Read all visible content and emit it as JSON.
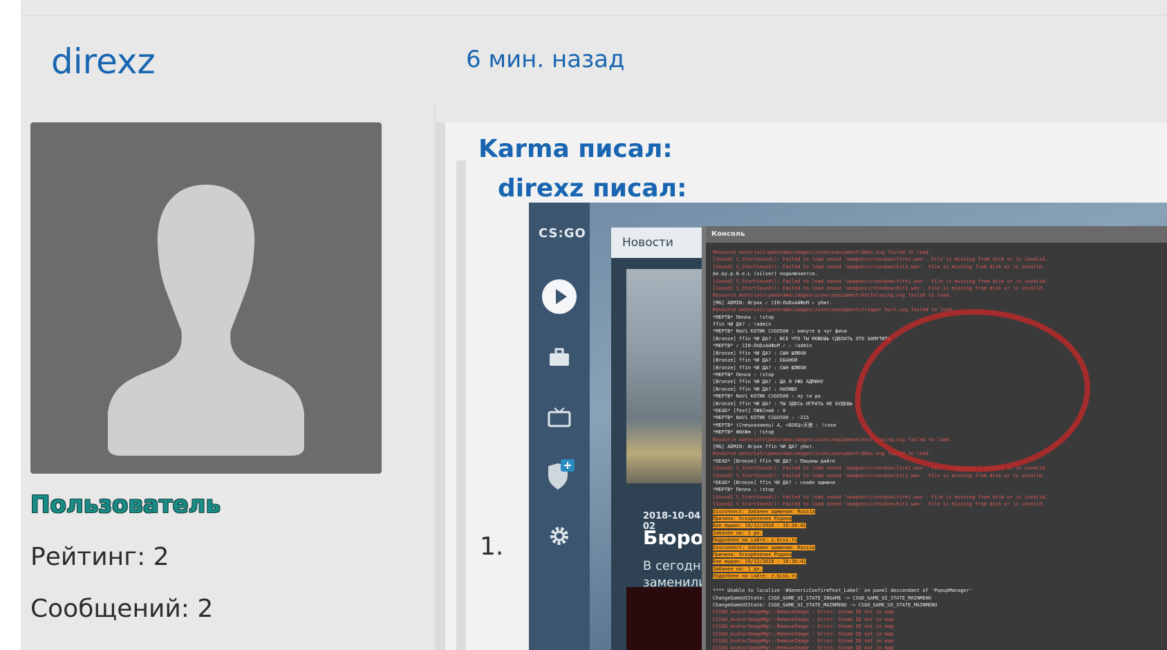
{
  "post": {
    "author": "direxz",
    "time": "6 мин. назад",
    "role": "Пользователь",
    "rating": "Рейтинг: 2",
    "messages": "Сообщений: 2"
  },
  "quotes": {
    "outer_header": "Karma писал:",
    "inner_header": "direxz писал:",
    "list_number": "1."
  },
  "screenshot": {
    "logo": "CS:GO",
    "news_header": "Новости",
    "news_date": "2018-10-04 02",
    "news_title": "Бюро",
    "news_text_1": "В сегодня",
    "news_text_2": "заменили",
    "console_title": "Консоль",
    "console_lines": [
      {
        "t": "Resource materials\\panorama\\images\\icons\\equipment\\dbox.svg failed to load.",
        "c": "red"
      },
      {
        "t": "[Sound] S_StartSound(): Failed to load sound 'weapons\\crossbow\\fire1.wav'. File is missing from disk or is invalid.",
        "c": "red"
      },
      {
        "t": "[Sound] S_StartSound(): Failed to load sound 'weapons\\crossbow\\hit1.wav'. File is missing from disk or is invalid.",
        "c": "red"
      },
      {
        "t": "Ae.&y.p.6.e.L (silver) подключается.",
        "c": "white"
      },
      {
        "t": "[Sound] S_StartSound(): Failed to load sound 'weapons\\crossbow\\fire1.wav'. File is missing from disk or is invalid.",
        "c": "red"
      },
      {
        "t": "[Sound] S_StartSound(): Failed to load sound 'weapons\\crossbow\\hit1.wav'. File is missing from disk or is invalid.",
        "c": "red"
      },
      {
        "t": "Resource materials\\panorama\\images\\icons\\equipment\\knifelaying.svg failed to load.",
        "c": "red"
      },
      {
        "t": " [MG] ADMIN: Игрок ✓ ΞΙΘ›ЛоDхАйФоМ ✓ убит.",
        "c": "white"
      },
      {
        "t": "Resource materials\\panorama\\images\\icons\\equipment\\trigger_hurt.svg failed to load.",
        "c": "red"
      },
      {
        "t": "*МЕРТВ* Пепла : !stop",
        "c": "white"
      },
      {
        "t": "ffin ЧИ ДА? : !admin",
        "c": "white"
      },
      {
        "t": "*МЕРТВ* NaVi КОТИК CSGO500 : кинуте в чуг фича",
        "c": "white"
      },
      {
        "t": "  [Bronze] ffin ЧИ ДА? :  ВСЕ ЧТО ТЫ МОЖЕШЬ СДЕЛАТЬ ЭТО ЗАМУТИТЬ",
        "c": "white"
      },
      {
        "t": "*МЕРТВ* ✓ ΞΙΘ›ЛоDхАйФоМ ✓ : !admin",
        "c": "white"
      },
      {
        "t": "  [Bronze] ffin ЧИ ДА? :  СЫН ШЛЮХИ",
        "c": "white"
      },
      {
        "t": "  [Bronze] ffin ЧИ ДА? :  ЕБАНОЙ",
        "c": "white"
      },
      {
        "t": "  [Bronze] ffin ЧИ ДА? :  СЫН ШЛЮХИ",
        "c": "white"
      },
      {
        "t": "*МЕРТВ* Пепла : !stop",
        "c": "white"
      },
      {
        "t": "  [Bronze] ffin ЧИ ДА? :  ДА Я УЖЕ АДМИНУ",
        "c": "white"
      },
      {
        "t": "  [Bronze] ffin ЧИ ДА? :  НАПИШУ",
        "c": "white"
      },
      {
        "t": "*МЕРТВ* NaVi КОТИК CSGO500 : ну ти да",
        "c": "white"
      },
      {
        "t": "  [Bronze] ffin ЧИ ДА? :  ТЫ ЗДЕСЬ ИГРАТЬ НЕ БУДЕШЬ",
        "c": "white"
      },
      {
        "t": "*DEAD*  [Test] ΠΦθΞний : 0",
        "c": "white"
      },
      {
        "t": "*МЕРТВ* NaVi КОТИК CSGO500 : -215",
        "c": "white"
      },
      {
        "t": "*МЕРТВ* (Спецназовец) A, <БОЕЦ>天使 :  !case",
        "c": "white"
      },
      {
        "t": "*МЕРТВ* ΦΘΧΦ⊕ : !stop",
        "c": "white"
      },
      {
        "t": "Resource materials\\panorama\\images\\icons\\equipment\\knifelaying.svg failed to load.",
        "c": "red"
      },
      {
        "t": " [MG] ADMIN: Игрок ffin ЧИ ДА? убит.",
        "c": "white"
      },
      {
        "t": "Resource materials\\panorama\\images\\icons\\equipment\\dbox.svg failed to load.",
        "c": "red"
      },
      {
        "t": "*DEAD*  [Bronze] ffin ЧИ ДА? :  Пацаны дайте",
        "c": "white"
      },
      {
        "t": "[Sound] S_StartSound(): Failed to load sound 'weapons\\crossbow\\fire1.wav'. File is missing from disk or is invalid.",
        "c": "red"
      },
      {
        "t": "[Sound] S_StartSound(): Failed to load sound 'weapons\\crossbow\\hit1.wav'. File is missing from disk or is invalid.",
        "c": "red"
      },
      {
        "t": "*DEAD*  [Bronze] ffin ЧИ ДА? :  скайп админа",
        "c": "white"
      },
      {
        "t": "*МЕРТВ* Пепла : !stop",
        "c": "white"
      },
      {
        "t": "[Sound] S_StartSound(): Failed to load sound 'weapons\\crossbow\\fire1.wav'. File is missing from disk or is invalid.",
        "c": "red"
      },
      {
        "t": "[Sound] S_StartSound(): Failed to load sound 'weapons\\crossbow\\hit1.wav'. File is missing from disk or is invalid.",
        "c": "red"
      },
      {
        "t": "Disconnect: Забанен админом: Russia",
        "c": "hl"
      },
      {
        "t": "Причина: Оскорбления Родина",
        "c": "hl"
      },
      {
        "t": "Бан выдан: 10/12/2018 - 16:36:41",
        "c": "hl"
      },
      {
        "t": "Забанен на: 1 дн.",
        "c": "hl"
      },
      {
        "t": "Подробнее на сайте: z.bcss.ru",
        "c": "hl"
      },
      {
        "t": "Disconnect: Забанен админом: Russia",
        "c": "hl"
      },
      {
        "t": "Причина: Оскорбления Родина",
        "c": "hl"
      },
      {
        "t": "Бан выдан: 10/12/2018 - 16:36:41",
        "c": "hl"
      },
      {
        "t": "Забанен на: 1 дн.",
        "c": "hl"
      },
      {
        "t": "Подробнее на сайте: z.bcss.ru",
        "c": "hl"
      },
      {
        "t": "",
        "c": "white"
      },
      {
        "t": "**** Unable to localize '#GenericConfirmText_Label' on panel descendant of 'PopupManager'",
        "c": "white"
      },
      {
        "t": "ChangeGameUIState: CSGO_GAME_UI_STATE_INGAME -> CSGO_GAME_UI_STATE_MAINMENU",
        "c": "white"
      },
      {
        "t": "ChangeGameUIState: CSGO_GAME_UI_STATE_MAINMENU -> CSGO_GAME_UI_STATE_MAINMENU",
        "c": "white"
      },
      {
        "t": "CCSGO_AvatarImageMgr::RemoveImage - Error: Steam ID not in map",
        "c": "red"
      },
      {
        "t": "CCSGO_AvatarImageMgr::RemoveImage - Error: Steam ID not in map",
        "c": "red"
      },
      {
        "t": "CCSGO_AvatarImageMgr::RemoveImage - Error: Steam ID not in map",
        "c": "red"
      },
      {
        "t": "CCSGO_AvatarImageMgr::RemoveImage - Error: Steam ID not in map",
        "c": "red"
      },
      {
        "t": "CCSGO_AvatarImageMgr::RemoveImage - Error: Steam ID not in map",
        "c": "red"
      },
      {
        "t": "CCSGO_AvatarImageMgr::RemoveImage - Error: Steam ID not in map",
        "c": "red"
      }
    ]
  },
  "icons": {
    "avatar": "user-silhouette-icon",
    "rail": [
      "play-icon",
      "briefcase-icon",
      "tv-icon",
      "shield-icon",
      "gear-icon"
    ]
  },
  "colors": {
    "link": "#1865b1",
    "role": "#1a8c86",
    "console_red": "#e35a5a",
    "console_highlight": "#f29a1c"
  }
}
